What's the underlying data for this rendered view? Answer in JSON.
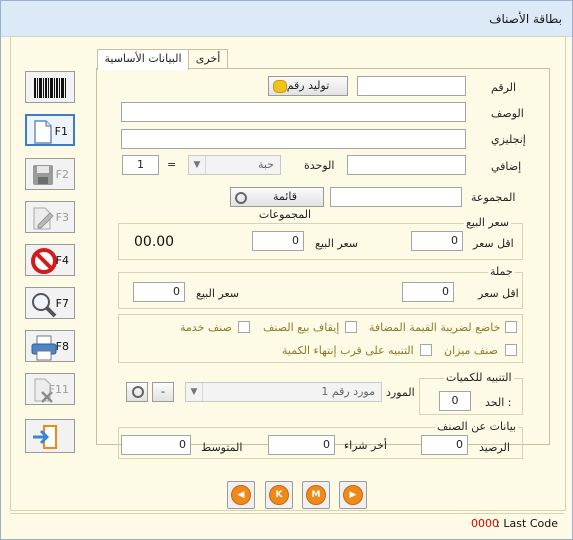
{
  "window": {
    "title": "بطاقة الأصناف"
  },
  "tabs": [
    {
      "label": "البيانات الأساسية"
    },
    {
      "label": "أخرى"
    }
  ],
  "toolbar": {
    "keys": {
      "f1": "F1",
      "f2": "F2",
      "f3": "F3",
      "f4": "F4",
      "f7": "F7",
      "f8": "F8",
      "f11": "F11"
    }
  },
  "form": {
    "code": {
      "label": "الرقم",
      "value": "",
      "generate_label": "توليد رقم"
    },
    "description": {
      "label": "الوصف",
      "value": ""
    },
    "english": {
      "label": "إنجليزي",
      "value": ""
    },
    "extra": {
      "label": "إضافي",
      "value": ""
    },
    "unit": {
      "label": "الوحدة",
      "value": "حبة",
      "equals": "=",
      "factor": "1"
    },
    "group": {
      "label": "المجموعة",
      "value": "",
      "button_label": "قائمة المجموعات"
    }
  },
  "sale_price": {
    "title": "سعر البيع",
    "min_label": "اقل سعر",
    "min_value": "0",
    "price_label": "سعر البيع",
    "price_value": "0",
    "display": "00.00"
  },
  "wholesale": {
    "title": "جملة",
    "min_label": "اقل سعر",
    "min_value": "0",
    "price_label": "سعر البيع",
    "price_value": "0"
  },
  "options": {
    "vat": "خاضع لضريبة القيمة المضافة",
    "stop_sale": "إيقاف بيع الصنف",
    "service": "صنف خدمة",
    "scale": "صنف ميزان",
    "expiry_alert": "التنبيه على قرب إنتهاء الكمية"
  },
  "qty_alert": {
    "title": "التنبيه للكميات",
    "limit_label": "الحد :",
    "limit_value": "0"
  },
  "supplier": {
    "label": "المورد",
    "value": "مورد رقم 1",
    "clear": "-"
  },
  "item_info": {
    "title": "بيانات عن الصنف",
    "balance_label": "الرصيد",
    "balance_value": "0",
    "last_purchase_label": "أخر شراء",
    "last_purchase_value": "0",
    "average_label": "المتوسط",
    "average_value": "0"
  },
  "nav": {
    "first": "◀",
    "prev": "K",
    "next": "M",
    "last": "▶"
  },
  "status": {
    "last_code_label": ": Last Code",
    "last_code_value": "0000"
  },
  "colors": {
    "accent": "#ef8a1a",
    "status_code": "#dd0000",
    "background": "#fdfbe6"
  }
}
